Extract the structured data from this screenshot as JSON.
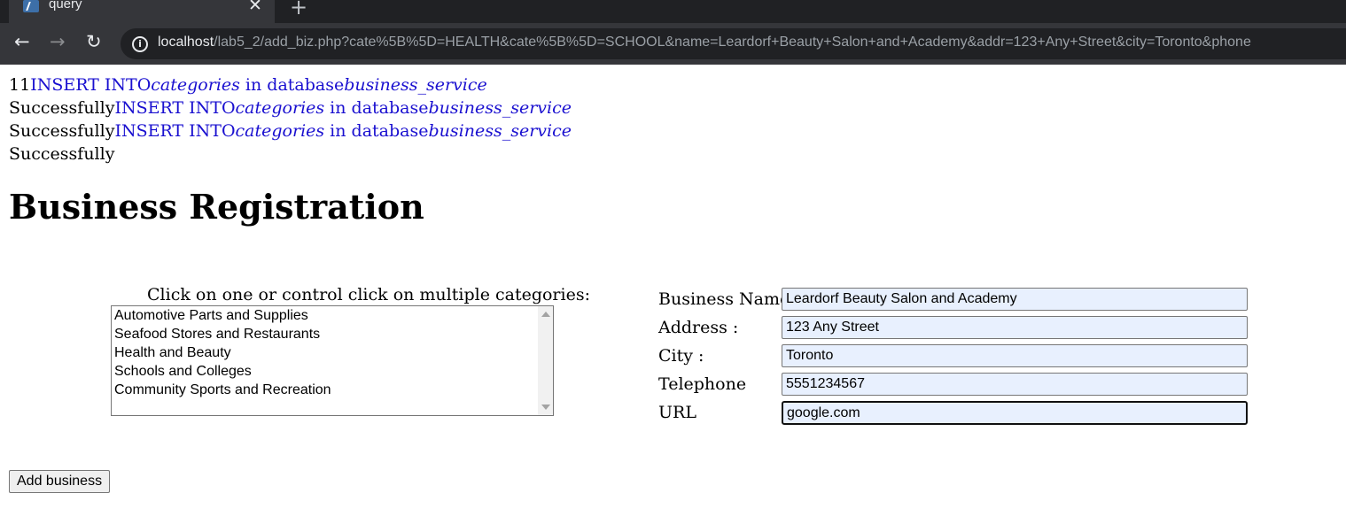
{
  "browser": {
    "tab_title": "query",
    "close_glyph": "✕",
    "new_tab_glyph": "+",
    "url_host": "localhost",
    "url_rest": "/lab5_2/add_biz.php?cate%5B%5D=HEALTH&cate%5B%5D=SCHOOL&name=Leardorf+Beauty+Salon+and+Academy&addr=123+Any+Street&city=Toronto&phone"
  },
  "log": {
    "prefix": "11",
    "insert_text": "INSERT INTO",
    "table": "categories",
    "in_db": " in database",
    "db": "business_service",
    "success": "Successfully"
  },
  "page": {
    "title": "Business Registration"
  },
  "categories": {
    "label": "Click on one or control click on multiple categories:",
    "options": [
      "Automotive Parts and Supplies",
      "Seafood Stores and Restaurants",
      "Health and Beauty",
      "Schools and Colleges",
      "Community Sports and Recreation"
    ]
  },
  "form": {
    "name_label": "Business Name :",
    "name_value": "Leardorf Beauty Salon and Academy",
    "address_label": "Address :",
    "address_value": "123 Any Street",
    "city_label": "City :",
    "city_value": "Toronto",
    "phone_label": "Telephone",
    "phone_value": "5551234567",
    "url_label": "URL",
    "url_value": "google.com",
    "submit_label": "Add business"
  }
}
